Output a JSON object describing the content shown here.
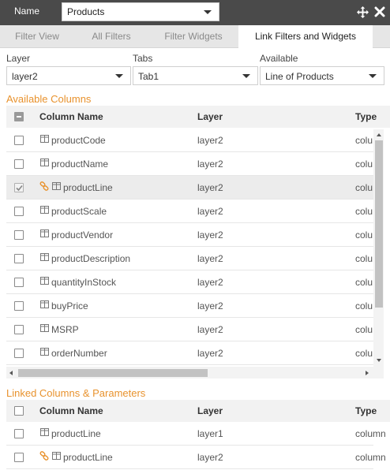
{
  "header": {
    "name_label": "Name",
    "name_value": "Products",
    "icons": [
      "move-icon",
      "close-icon"
    ]
  },
  "tabs": [
    {
      "label": "Filter View",
      "active": false
    },
    {
      "label": "All Filters",
      "active": false
    },
    {
      "label": "Filter Widgets",
      "active": false
    },
    {
      "label": "Link Filters and Widgets",
      "active": true
    }
  ],
  "selectors": {
    "layer": {
      "label": "Layer",
      "value": "layer2"
    },
    "tabs": {
      "label": "Tabs",
      "value": "Tab1"
    },
    "available": {
      "label": "Available",
      "value": "Line of Products"
    }
  },
  "available_columns": {
    "title": "Available Columns",
    "headers": {
      "name": "Column Name",
      "layer": "Layer",
      "type": "Type"
    },
    "rows": [
      {
        "name": "productCode",
        "layer": "layer2",
        "type": "colu",
        "checked": false,
        "linked": false
      },
      {
        "name": "productName",
        "layer": "layer2",
        "type": "colu",
        "checked": false,
        "linked": false
      },
      {
        "name": "productLine",
        "layer": "layer2",
        "type": "colu",
        "checked": true,
        "linked": true
      },
      {
        "name": "productScale",
        "layer": "layer2",
        "type": "colu",
        "checked": false,
        "linked": false
      },
      {
        "name": "productVendor",
        "layer": "layer2",
        "type": "colu",
        "checked": false,
        "linked": false
      },
      {
        "name": "productDescription",
        "layer": "layer2",
        "type": "colu",
        "checked": false,
        "linked": false
      },
      {
        "name": "quantityInStock",
        "layer": "layer2",
        "type": "colu",
        "checked": false,
        "linked": false
      },
      {
        "name": "buyPrice",
        "layer": "layer2",
        "type": "colu",
        "checked": false,
        "linked": false
      },
      {
        "name": "MSRP",
        "layer": "layer2",
        "type": "colu",
        "checked": false,
        "linked": false
      },
      {
        "name": "orderNumber",
        "layer": "layer2",
        "type": "colu",
        "checked": false,
        "linked": false
      }
    ]
  },
  "linked_columns": {
    "title": "Linked Columns & Parameters",
    "headers": {
      "name": "Column Name",
      "layer": "Layer",
      "type": "Type"
    },
    "rows": [
      {
        "name": "productLine",
        "layer": "layer1",
        "type": "column",
        "linked": false
      },
      {
        "name": "productLine",
        "layer": "layer2",
        "type": "column",
        "linked": true
      }
    ]
  },
  "colors": {
    "accent": "#e8922d",
    "titlebar": "#4a4a4a",
    "link": "#e8922d"
  }
}
